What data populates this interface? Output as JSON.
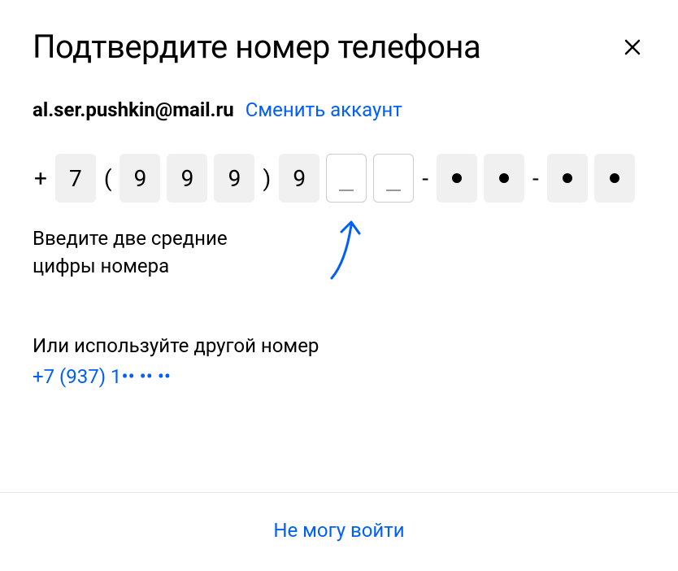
{
  "header": {
    "title": "Подтвердите номер телефона"
  },
  "account": {
    "email": "al.ser.pushkin@mail.ru",
    "change_label": "Сменить аккаунт"
  },
  "phone": {
    "plus": "+",
    "country": "7",
    "open_paren": "(",
    "close_paren": ")",
    "d1": "9",
    "d2": "9",
    "d3": "9",
    "d4": "9",
    "dash": "-"
  },
  "hint": {
    "text": "Введите две средние цифры номера"
  },
  "alt": {
    "label": "Или используйте другой номер",
    "phone": "+7 (937) 1•• •• ••"
  },
  "footer": {
    "cant_login": "Не могу войти"
  }
}
